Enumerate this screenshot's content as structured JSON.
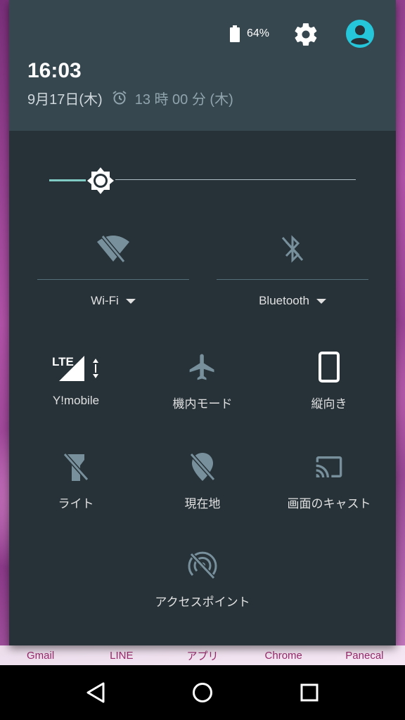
{
  "status": {
    "battery_pct": "64%"
  },
  "header": {
    "time": "16:03",
    "date": "9月17日(木)",
    "alarm": "13 時 00 分 (木)"
  },
  "brightness": {
    "level": 0.12
  },
  "toggles": {
    "wifi": {
      "label": "Wi-Fi",
      "icon": "wifi-off-icon"
    },
    "bluetooth": {
      "label": "Bluetooth",
      "icon": "bluetooth-off-icon"
    }
  },
  "tiles": {
    "mobile": {
      "label": "Y!mobile",
      "icon": "lte-signal-icon",
      "badge": "LTE"
    },
    "airplane": {
      "label": "機内モード",
      "icon": "airplane-icon"
    },
    "rotation": {
      "label": "縦向き",
      "icon": "portrait-phone-icon"
    },
    "flashlight": {
      "label": "ライト",
      "icon": "flashlight-off-icon"
    },
    "location": {
      "label": "現在地",
      "icon": "location-off-icon"
    },
    "cast": {
      "label": "画面のキャスト",
      "icon": "cast-icon"
    },
    "hotspot": {
      "label": "アクセスポイント",
      "icon": "hotspot-off-icon"
    }
  },
  "dock": [
    "Gmail",
    "LINE",
    "アプリ",
    "Chrome",
    "Panecal"
  ],
  "colors": {
    "shade_bg": "#263238",
    "header_bg": "#37474f",
    "accent": "#80cbc4",
    "avatar": "#26c6da",
    "inactive_icon": "#78909c",
    "dock_text": "#9a2a6d"
  }
}
